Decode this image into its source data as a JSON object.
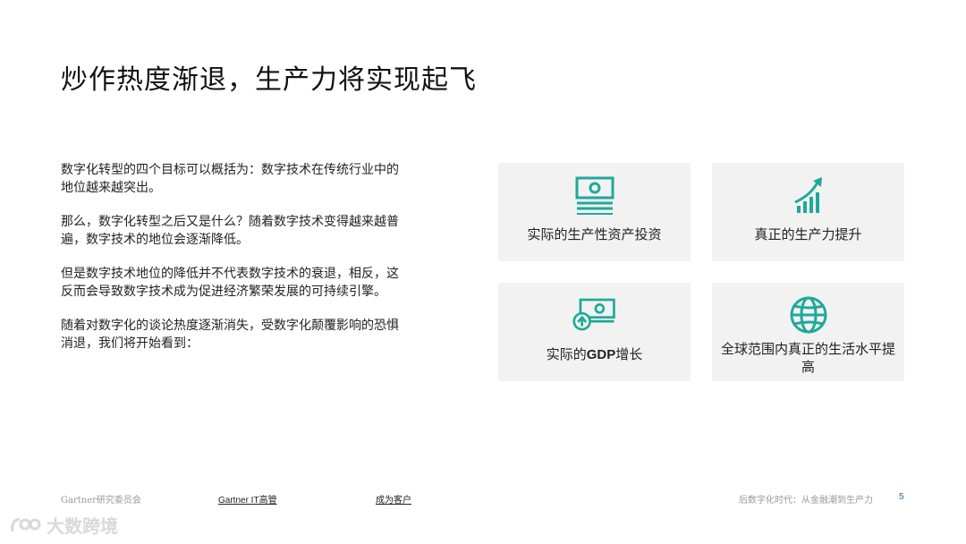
{
  "title": "炒作热度渐退，生产力将实现起飞",
  "paragraphs": [
    "数字化转型的四个目标可以概括为：数字技术在传统行业中的地位越来越突出。",
    "那么，数字化转型之后又是什么？随着数字技术变得越来越普遍，数字技术的地位会逐渐降低。",
    "但是数字技术地位的降低并不代表数字技术的衰退，相反，这反而会导致数字技术成为促进经济繁荣发展的可持续引擎。",
    "随着对数字化的谈论热度逐渐消失，受数字化颠覆影响的恐惧消退，我们将开始看到："
  ],
  "cards": [
    {
      "label": "实际的生产性资产投资",
      "icon": "cash-icon"
    },
    {
      "label": "真正的生产力提升",
      "icon": "growth-chart-icon"
    },
    {
      "label_prefix": "实际的",
      "label_bold": "GDP",
      "label_suffix": "增长",
      "icon": "money-up-icon"
    },
    {
      "label": "全球范围内真正的生活水平提高",
      "icon": "globe-icon"
    }
  ],
  "footer": {
    "org": "Gartner研究委员会",
    "link1": "Gartner IT高管",
    "link2": "成为客户",
    "doc_title": "后数字化时代：从金融潮到生产力",
    "page_number": "5"
  },
  "watermark": "大数跨境",
  "colors": {
    "accent": "#1fa99a",
    "card_bg": "#f2f2f2",
    "page_number": "#1f5fa8"
  }
}
